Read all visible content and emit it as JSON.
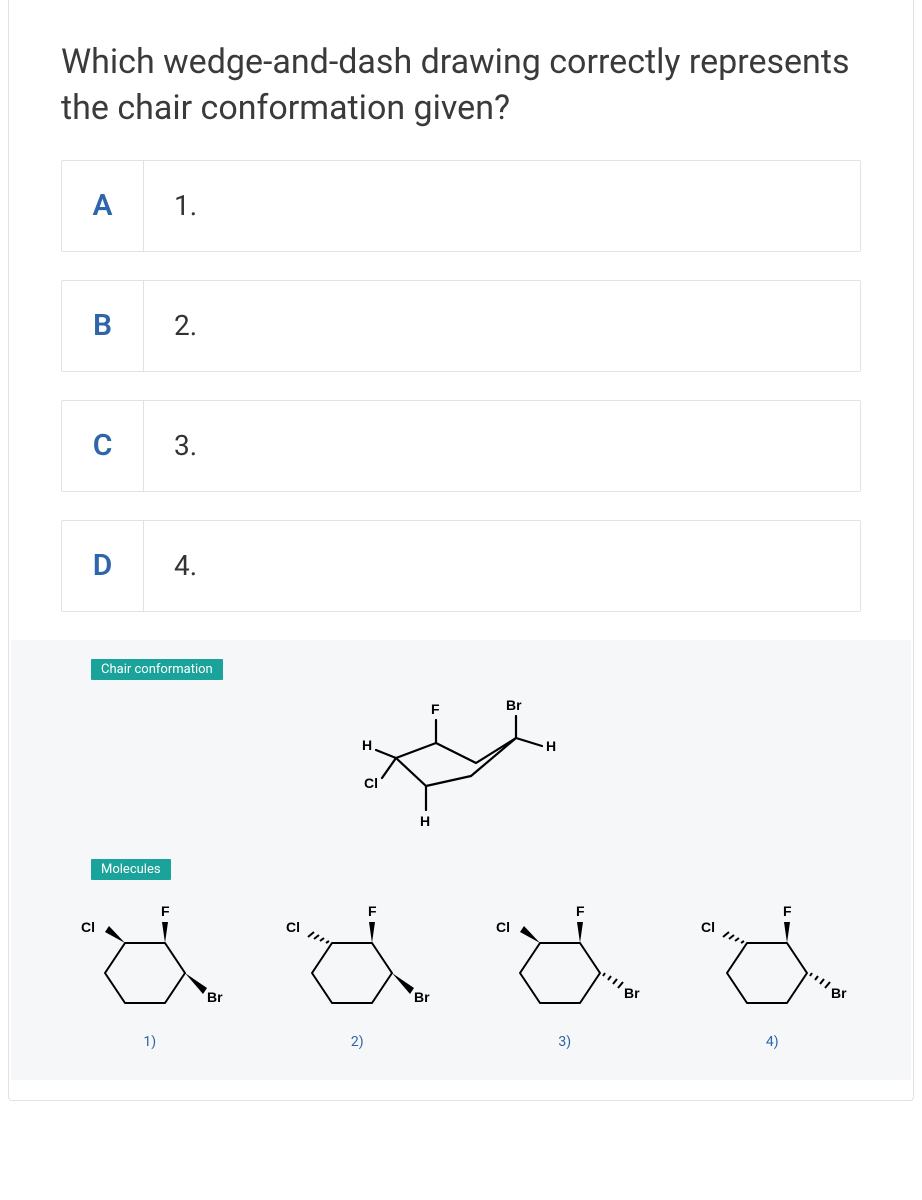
{
  "question": "Which wedge-and-dash drawing correctly represents the chair conformation given?",
  "options": [
    {
      "letter": "A",
      "label": "1."
    },
    {
      "letter": "B",
      "label": "2."
    },
    {
      "letter": "C",
      "label": "3."
    },
    {
      "letter": "D",
      "label": "4."
    }
  ],
  "tags": {
    "chair": "Chair conformation",
    "molecules": "Molecules"
  },
  "chair_atoms": {
    "F": "F",
    "Br": "Br",
    "H1": "H",
    "H2": "H",
    "H3": "H",
    "Cl": "Cl"
  },
  "molecules": [
    {
      "num": "1)",
      "F": "F",
      "Cl": "Cl",
      "Br": "Br",
      "cl_wedge": "solid",
      "br_wedge": "solid"
    },
    {
      "num": "2)",
      "F": "F",
      "Cl": "Cl",
      "Br": "Br",
      "cl_wedge": "dash",
      "br_wedge": "solid"
    },
    {
      "num": "3)",
      "F": "F",
      "Cl": "Cl",
      "Br": "Br",
      "cl_wedge": "solid",
      "br_wedge": "dash"
    },
    {
      "num": "4)",
      "F": "F",
      "Cl": "Cl",
      "Br": "Br",
      "cl_wedge": "dash",
      "br_wedge": "dash"
    }
  ]
}
